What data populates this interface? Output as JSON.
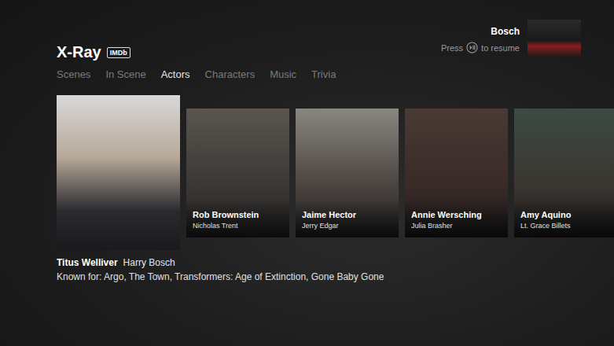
{
  "panel": {
    "title": "X-Ray",
    "badge": "IMDb"
  },
  "tabs": [
    {
      "label": "Scenes",
      "selected": false
    },
    {
      "label": "In Scene",
      "selected": false
    },
    {
      "label": "Actors",
      "selected": true
    },
    {
      "label": "Characters",
      "selected": false
    },
    {
      "label": "Music",
      "selected": false
    },
    {
      "label": "Trivia",
      "selected": false
    }
  ],
  "now_playing": {
    "title": "Bosch",
    "hint_before": "Press",
    "hint_after": "to resume"
  },
  "actors": [
    {
      "name": "Titus Welliver",
      "character": "Harry Bosch",
      "selected": true,
      "known_for": "Known for: Argo, The Town, Transformers: Age of Extinction, Gone Baby Gone"
    },
    {
      "name": "Rob Brownstein",
      "character": "Nicholas Trent",
      "selected": false,
      "known_for": ""
    },
    {
      "name": "Jaime Hector",
      "character": "Jerry Edgar",
      "selected": false,
      "known_for": ""
    },
    {
      "name": "Annie Wersching",
      "character": "Julia Brasher",
      "selected": false,
      "known_for": ""
    },
    {
      "name": "Amy Aquino",
      "character": "Lt. Grace Billets",
      "selected": false,
      "known_for": ""
    }
  ]
}
